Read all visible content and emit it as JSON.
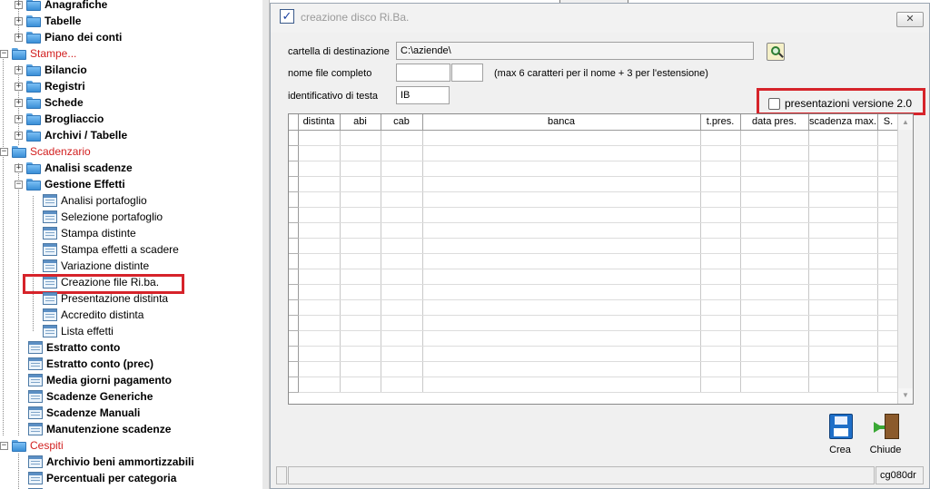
{
  "tree": {
    "nodes": [
      {
        "key": "anagrafiche",
        "label": "Anagrafiche",
        "type": "folder",
        "level": 1,
        "bold": true,
        "expander": "+"
      },
      {
        "key": "tabelle",
        "label": "Tabelle",
        "type": "folder",
        "level": 1,
        "bold": true,
        "expander": "+"
      },
      {
        "key": "piano-dei-conti",
        "label": "Piano dei conti",
        "type": "folder",
        "level": 1,
        "bold": true,
        "expander": "+"
      },
      {
        "key": "stampe",
        "label": "Stampe...",
        "type": "folder",
        "level": 0,
        "red": true,
        "expander": "-"
      },
      {
        "key": "bilancio",
        "label": "Bilancio",
        "type": "folder",
        "level": 1,
        "bold": true,
        "expander": "+"
      },
      {
        "key": "registri",
        "label": "Registri",
        "type": "folder",
        "level": 1,
        "bold": true,
        "expander": "+"
      },
      {
        "key": "schede",
        "label": "Schede",
        "type": "folder",
        "level": 1,
        "bold": true,
        "expander": "+"
      },
      {
        "key": "brogliaccio",
        "label": "Brogliaccio",
        "type": "folder",
        "level": 1,
        "bold": true,
        "expander": "+"
      },
      {
        "key": "archivi-tabelle",
        "label": "Archivi / Tabelle",
        "type": "folder",
        "level": 1,
        "bold": true,
        "expander": "+"
      },
      {
        "key": "scadenzario",
        "label": "Scadenzario",
        "type": "folder",
        "level": 0,
        "red": true,
        "expander": "-"
      },
      {
        "key": "analisi-scadenze",
        "label": "Analisi scadenze",
        "type": "folder",
        "level": 1,
        "bold": true,
        "expander": "+"
      },
      {
        "key": "gestione-effetti",
        "label": "Gestione Effetti",
        "type": "folder",
        "level": 1,
        "bold": true,
        "expander": "-"
      },
      {
        "key": "analisi-portafoglio",
        "label": "Analisi portafoglio",
        "type": "doc",
        "level": 2
      },
      {
        "key": "selezione-portafoglio",
        "label": "Selezione portafoglio",
        "type": "doc",
        "level": 2
      },
      {
        "key": "stampa-distinte",
        "label": "Stampa distinte",
        "type": "doc",
        "level": 2
      },
      {
        "key": "stampa-effetti-a-scadere",
        "label": "Stampa effetti a scadere",
        "type": "doc",
        "level": 2
      },
      {
        "key": "variazione-distinte",
        "label": "Variazione distinte",
        "type": "doc",
        "level": 2
      },
      {
        "key": "creazione-file-riba",
        "label": "Creazione file Ri.ba.",
        "type": "doc",
        "level": 2,
        "highlighted": true
      },
      {
        "key": "presentazione-distinta",
        "label": "Presentazione distinta",
        "type": "doc",
        "level": 2
      },
      {
        "key": "accredito-distinta",
        "label": "Accredito distinta",
        "type": "doc",
        "level": 2
      },
      {
        "key": "lista-effetti",
        "label": "Lista effetti",
        "type": "doc",
        "level": 2
      },
      {
        "key": "estratto-conto",
        "label": "Estratto conto",
        "type": "doc",
        "level": 1,
        "bold": true
      },
      {
        "key": "estratto-conto-prec",
        "label": "Estratto conto (prec)",
        "type": "doc",
        "level": 1,
        "bold": true
      },
      {
        "key": "media-giorni-pagamento",
        "label": "Media giorni pagamento",
        "type": "doc",
        "level": 1,
        "bold": true
      },
      {
        "key": "scadenze-generiche",
        "label": "Scadenze Generiche",
        "type": "doc",
        "level": 1,
        "bold": true
      },
      {
        "key": "scadenze-manuali",
        "label": "Scadenze Manuali",
        "type": "doc",
        "level": 1,
        "bold": true
      },
      {
        "key": "manutenzione-scadenze",
        "label": "Manutenzione scadenze",
        "type": "doc",
        "level": 1,
        "bold": true
      },
      {
        "key": "cespiti",
        "label": "Cespiti",
        "type": "folder",
        "level": 0,
        "red": true,
        "expander": "-"
      },
      {
        "key": "archivio-beni-ammortizzabili",
        "label": "Archivio beni ammortizzabili",
        "type": "doc",
        "level": 1,
        "bold": true
      },
      {
        "key": "percentuali-per-categoria",
        "label": "Percentuali per categoria",
        "type": "doc",
        "level": 1,
        "bold": true
      },
      {
        "key": "partial-item",
        "label": "",
        "type": "doc",
        "level": 1,
        "bold": true
      }
    ]
  },
  "dialog": {
    "title": "creazione disco Ri.Ba.",
    "close_label": "✕",
    "fields": {
      "dest_folder_label": "cartella di destinazione",
      "dest_folder_value": "C:\\aziende\\",
      "filename_label": "nome file completo",
      "filename_value": "",
      "extension_value": "",
      "filename_hint": "(max 6 caratteri per il nome + 3 per l'estensione)",
      "header_id_label": "identificativo di testa",
      "header_id_value": "IB"
    },
    "presentation_checkbox": {
      "label": "presentazioni versione 2.0",
      "checked": false
    },
    "grid": {
      "columns": [
        "distinta",
        "abi",
        "cab",
        "banca",
        "t.pres.",
        "data pres.",
        "scadenza max.",
        "S."
      ],
      "rows": []
    },
    "buttons": {
      "crea": "Crea",
      "chiude": "Chiude"
    },
    "status": {
      "left": "",
      "middle": "",
      "right": "cg080dr"
    }
  },
  "colors": {
    "highlight": "#d6232a",
    "red_label": "#d21f1f"
  }
}
